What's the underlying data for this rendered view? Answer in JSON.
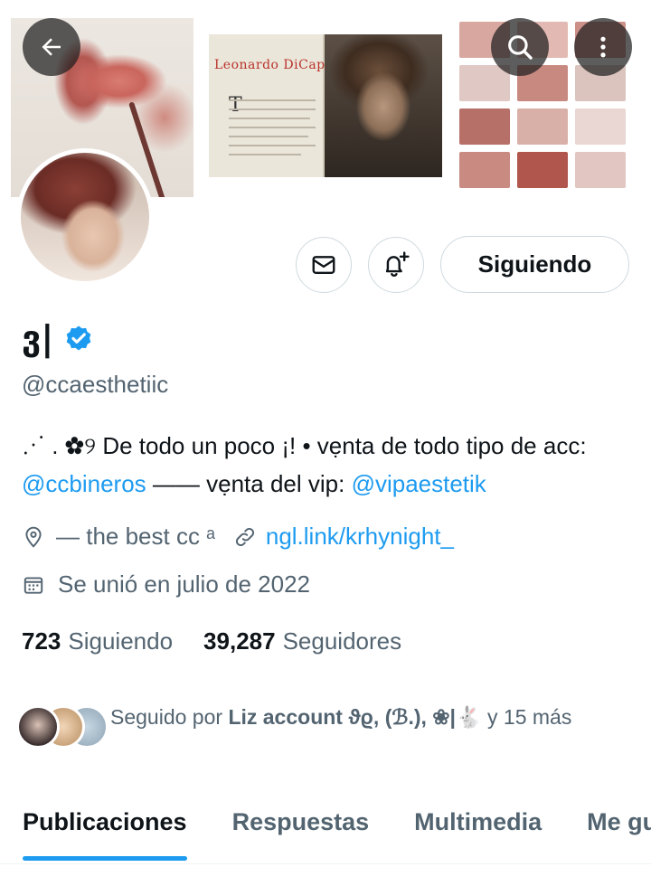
{
  "banner": {
    "magazine_title": "Leonardo DiCaprio",
    "magazine_dropcap": "T"
  },
  "header_icons": {
    "back": "arrow-left-icon",
    "search": "search-icon",
    "more": "more-vertical-icon"
  },
  "actions": {
    "message_icon": "mail-icon",
    "notify_icon": "bell-plus-icon",
    "follow_label": "Siguiendo"
  },
  "profile": {
    "display_name": "ვ|",
    "verified": true,
    "handle": "@ccaesthetiic",
    "bio_intro": "⋰ . ✿୨ De todo un poco ¡! • vẹnta de todo tipo de acc: ",
    "bio_link1": "@ccbineros",
    "bio_mid": " —— vẹnta del vip: ",
    "bio_link2": "@vipaestetik",
    "location": "— the best cc ᵃ",
    "website": "ngl.link/krhynight_",
    "joined": "Se unió en julio de 2022"
  },
  "stats": {
    "following_count": "723",
    "following_label": "Siguiendo",
    "followers_count": "39,287",
    "followers_label": "Seguidores"
  },
  "followed_by": {
    "prefix": "Seguido por ",
    "names": "Liz account ϑϱ, (ℬ.), ❀|🐇",
    "suffix": " y 15 más"
  },
  "tabs": [
    {
      "label": "Publicaciones",
      "active": true
    },
    {
      "label": "Respuestas",
      "active": false
    },
    {
      "label": "Multimedia",
      "active": false
    },
    {
      "label": "Me gusta",
      "active": false
    }
  ],
  "colors": {
    "accent": "#1d9bf0",
    "text_primary": "#0f1419",
    "text_secondary": "#536471",
    "border": "#cfd9de"
  }
}
